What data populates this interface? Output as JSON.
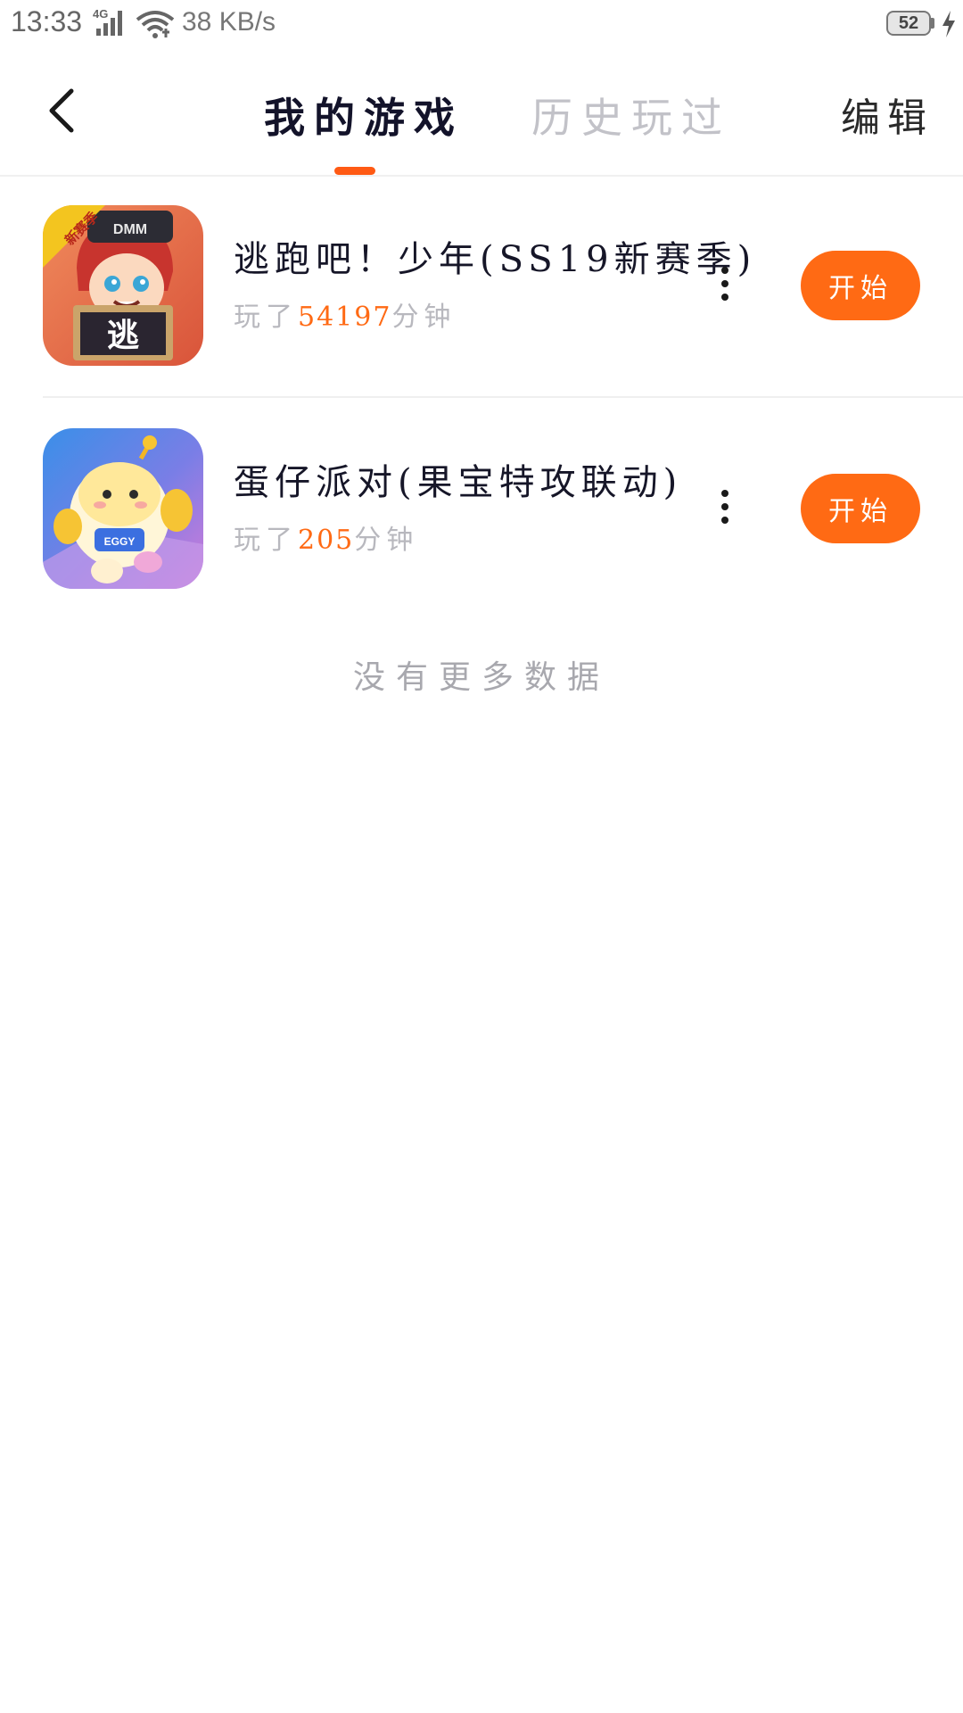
{
  "status_bar": {
    "time": "13:33",
    "network_type": "4G",
    "speed": "38 KB/s",
    "battery": "52"
  },
  "header": {
    "tabs": [
      {
        "label": "我的游戏",
        "active": true
      },
      {
        "label": "历史玩过",
        "active": false
      }
    ],
    "edit_label": "编辑"
  },
  "games": [
    {
      "title": "逃跑吧！少年(SS19新赛季)",
      "played_prefix": "玩了",
      "minutes": "54197",
      "played_suffix": "分钟",
      "start_label": "开始",
      "icon": "game-icon-escape",
      "icon_badge": "新赛季",
      "icon_sign": "逃",
      "icon_hat_text": "DMM"
    },
    {
      "title": "蛋仔派对(果宝特攻联动)",
      "played_prefix": "玩了",
      "minutes": "205",
      "played_suffix": "分钟",
      "start_label": "开始",
      "icon": "game-icon-eggy-party",
      "icon_badge_text": "EGGY"
    }
  ],
  "footer_text": "没有更多数据",
  "colors": {
    "accent": "#ff6a14",
    "tab_indicator": "#ff5a14",
    "title": "#161628",
    "muted": "#b8b8be"
  }
}
